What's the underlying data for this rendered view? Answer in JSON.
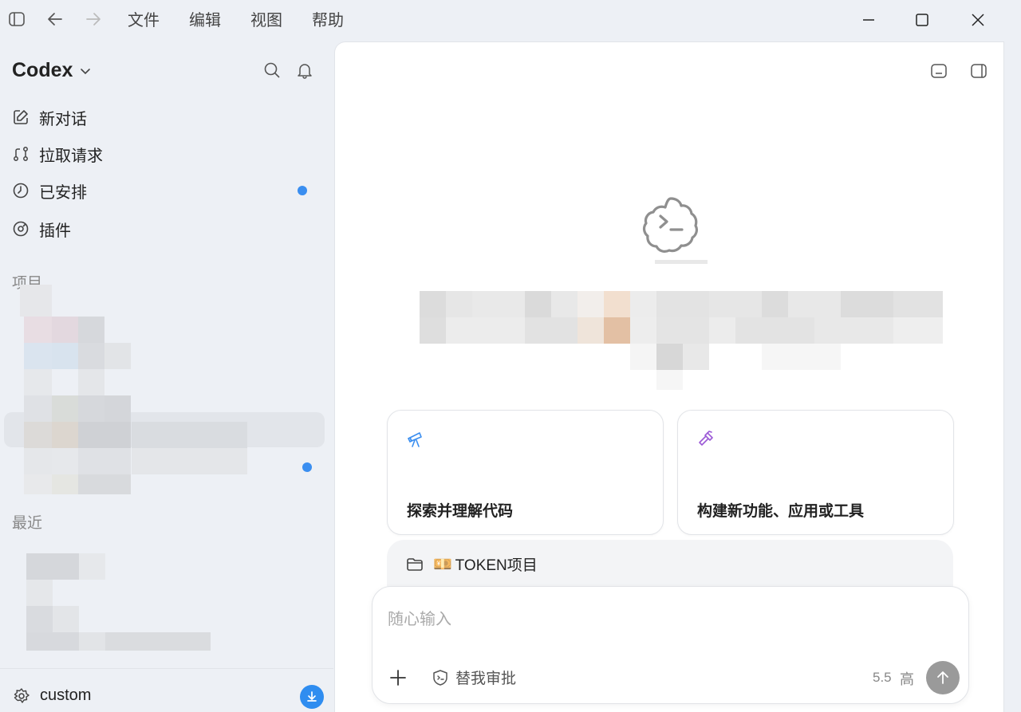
{
  "menu": [
    "文件",
    "编辑",
    "视图",
    "帮助"
  ],
  "sidebar": {
    "brand": "Codex",
    "nav": [
      {
        "label": "新对话",
        "icon": "edit-icon"
      },
      {
        "label": "拉取请求",
        "icon": "pull-request-icon"
      },
      {
        "label": "已安排",
        "icon": "clock-icon",
        "dot": true
      },
      {
        "label": "插件",
        "icon": "plugin-icon"
      }
    ],
    "section_projects": "项目",
    "section_recent": "最近",
    "footer_label": "custom"
  },
  "cards": [
    {
      "label": "探索并理解代码",
      "icon": "telescope-icon"
    },
    {
      "label": "构建新功能、应用或工具",
      "icon": "hammer-icon"
    }
  ],
  "project": {
    "emoji": "💴",
    "name": "TOKEN项目"
  },
  "composer": {
    "placeholder": "随心输入",
    "approve_label": "替我审批",
    "model": "5.5",
    "level": "高"
  },
  "colors": {
    "accent": "#3a8ef0",
    "explore_icon": "#3a8ef0",
    "build_icon": "#9b59d6"
  }
}
